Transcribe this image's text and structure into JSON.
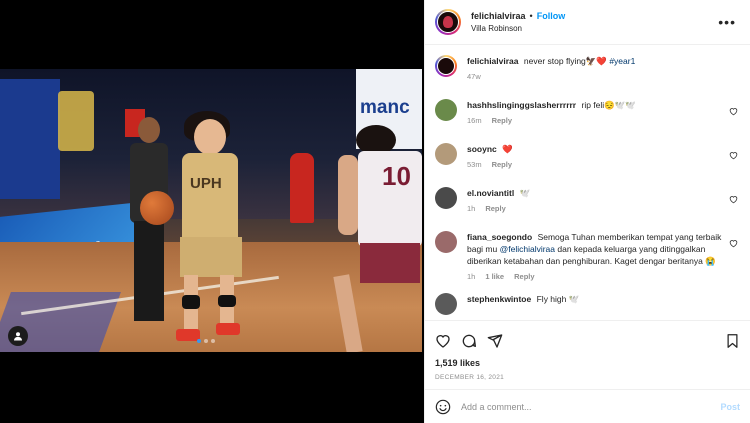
{
  "post": {
    "username": "felichialviraa",
    "follow_label": "Follow",
    "location": "Villa Robinson",
    "likes": "1,519 likes",
    "date": "DECEMBER 16, 2021"
  },
  "photo": {
    "sponsor_text": "manc",
    "jersey_main": "UPH",
    "jersey_number_defender": "10",
    "ad_board_text": "////"
  },
  "caption": {
    "username": "felichialviraa",
    "text": "never stop flying🦅❤️",
    "hashtag": "#year1",
    "age": "47w"
  },
  "comments": [
    {
      "username": "hashhslinginggslasherrrrrr",
      "text": "rip feli😔🕊️🕊️",
      "age": "16m",
      "reply": "Reply",
      "avatar_color": "#6a8a4a"
    },
    {
      "username": "sooync",
      "text": "❤️",
      "age": "53m",
      "reply": "Reply",
      "avatar_color": "#b39a7a"
    },
    {
      "username": "el.noviantitl",
      "text": "🕊️",
      "age": "1h",
      "reply": "Reply",
      "avatar_color": "#4a4a4a"
    },
    {
      "username": "fiana_soegondo",
      "text_before": "Semoga Tuhan memberikan tempat yang terbaik bagi mu ",
      "mention": "@felichialviraa",
      "text_after": " dan kepada keluarga yang ditinggalkan diberikan ketabahan dan penghiburan. Kaget dengar beritanya 😭",
      "age": "1h",
      "likes": "1 like",
      "reply": "Reply",
      "avatar_color": "#9a6a6a"
    },
    {
      "username": "stephenkwintoe",
      "text": "Fly high 🕊️",
      "avatar_color": "#5a5a5a"
    }
  ],
  "add_comment": {
    "placeholder": "Add a comment...",
    "post_label": "Post"
  },
  "colors": {
    "follow": "#0095f6",
    "link": "#00376b",
    "muted": "#8e8e8e",
    "post_disabled": "#b3dbff"
  }
}
